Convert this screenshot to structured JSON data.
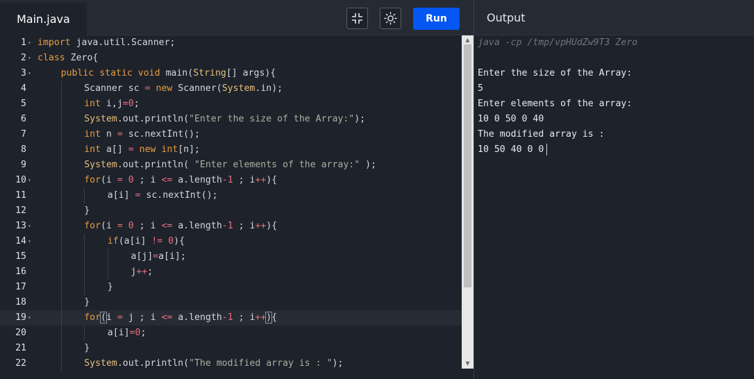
{
  "editor": {
    "tab_label": "Main.java",
    "run_label": "Run",
    "lines": [
      {
        "num": "1",
        "indent": 0,
        "fold": true
      },
      {
        "num": "2",
        "indent": 0,
        "fold": true
      },
      {
        "num": "3",
        "indent": 1,
        "fold": true
      },
      {
        "num": "4",
        "indent": 2
      },
      {
        "num": "5",
        "indent": 2
      },
      {
        "num": "6",
        "indent": 2
      },
      {
        "num": "7",
        "indent": 2
      },
      {
        "num": "8",
        "indent": 2
      },
      {
        "num": "9",
        "indent": 2
      },
      {
        "num": "10",
        "indent": 2,
        "fold": true
      },
      {
        "num": "11",
        "indent": 3
      },
      {
        "num": "12",
        "indent": 2
      },
      {
        "num": "13",
        "indent": 2,
        "fold": true
      },
      {
        "num": "14",
        "indent": 3,
        "fold": true
      },
      {
        "num": "15",
        "indent": 4
      },
      {
        "num": "16",
        "indent": 4
      },
      {
        "num": "17",
        "indent": 3
      },
      {
        "num": "18",
        "indent": 2
      },
      {
        "num": "19",
        "indent": 2,
        "fold": true,
        "active": true
      },
      {
        "num": "20",
        "indent": 3
      },
      {
        "num": "21",
        "indent": 2
      },
      {
        "num": "22",
        "indent": 2
      }
    ],
    "tokens": {
      "l1": [
        [
          "kw",
          "import"
        ],
        [
          "sy",
          " java.util.Scanner;"
        ]
      ],
      "l2": [
        [
          "kw",
          "class"
        ],
        [
          "sy",
          " Zero{"
        ]
      ],
      "l3": [
        [
          "kw",
          "public"
        ],
        [
          "sy",
          " "
        ],
        [
          "kw",
          "static"
        ],
        [
          "sy",
          " "
        ],
        [
          "kw",
          "void"
        ],
        [
          "sy",
          " main("
        ],
        [
          "ty",
          "String"
        ],
        [
          "sy",
          "[] args){"
        ]
      ],
      "l4": [
        [
          "sy",
          "Scanner sc "
        ],
        [
          "op",
          "="
        ],
        [
          "sy",
          " "
        ],
        [
          "kw",
          "new"
        ],
        [
          "sy",
          " Scanner("
        ],
        [
          "ty",
          "System"
        ],
        [
          "sy",
          ".in);"
        ]
      ],
      "l5": [
        [
          "kw",
          "int"
        ],
        [
          "sy",
          " i,j"
        ],
        [
          "op",
          "="
        ],
        [
          "nm",
          "0"
        ],
        [
          "sy",
          ";"
        ]
      ],
      "l6": [
        [
          "ty",
          "System"
        ],
        [
          "sy",
          ".out.println("
        ],
        [
          "st",
          "\"Enter the size of the Array:\""
        ],
        [
          "sy",
          ");"
        ]
      ],
      "l7": [
        [
          "kw",
          "int"
        ],
        [
          "sy",
          " n "
        ],
        [
          "op",
          "="
        ],
        [
          "sy",
          " sc.nextInt();"
        ]
      ],
      "l8": [
        [
          "kw",
          "int"
        ],
        [
          "sy",
          " a[] "
        ],
        [
          "op",
          "="
        ],
        [
          "sy",
          " "
        ],
        [
          "kw",
          "new"
        ],
        [
          "sy",
          " "
        ],
        [
          "kw",
          "int"
        ],
        [
          "sy",
          "[n];"
        ]
      ],
      "l9": [
        [
          "ty",
          "System"
        ],
        [
          "sy",
          ".out.println( "
        ],
        [
          "st",
          "\"Enter elements of the array:\""
        ],
        [
          "sy",
          " );"
        ]
      ],
      "l10": [
        [
          "kw",
          "for"
        ],
        [
          "sy",
          "(i "
        ],
        [
          "op",
          "="
        ],
        [
          "sy",
          " "
        ],
        [
          "nm",
          "0"
        ],
        [
          "sy",
          " ; i "
        ],
        [
          "op",
          "<="
        ],
        [
          "sy",
          " a.length"
        ],
        [
          "op",
          "-1"
        ],
        [
          "sy",
          " ; i"
        ],
        [
          "op",
          "++"
        ],
        [
          "sy",
          "){"
        ]
      ],
      "l11": [
        [
          "sy",
          "a[i] "
        ],
        [
          "op",
          "="
        ],
        [
          "sy",
          " sc.nextInt();"
        ]
      ],
      "l12": [
        [
          "sy",
          "}"
        ]
      ],
      "l13": [
        [
          "kw",
          "for"
        ],
        [
          "sy",
          "(i "
        ],
        [
          "op",
          "="
        ],
        [
          "sy",
          " "
        ],
        [
          "nm",
          "0"
        ],
        [
          "sy",
          " ; i "
        ],
        [
          "op",
          "<="
        ],
        [
          "sy",
          " a.length"
        ],
        [
          "op",
          "-1"
        ],
        [
          "sy",
          " ; i"
        ],
        [
          "op",
          "++"
        ],
        [
          "sy",
          "){"
        ]
      ],
      "l14": [
        [
          "kw",
          "if"
        ],
        [
          "sy",
          "(a[i] "
        ],
        [
          "op",
          "!="
        ],
        [
          "sy",
          " "
        ],
        [
          "nm",
          "0"
        ],
        [
          "sy",
          "){"
        ]
      ],
      "l15": [
        [
          "sy",
          "a[j]"
        ],
        [
          "op",
          "="
        ],
        [
          "sy",
          "a[i];"
        ]
      ],
      "l16": [
        [
          "sy",
          "j"
        ],
        [
          "op",
          "++"
        ],
        [
          "sy",
          ";"
        ]
      ],
      "l17": [
        [
          "sy",
          "}"
        ]
      ],
      "l18": [
        [
          "sy",
          "}"
        ]
      ],
      "l19": [
        [
          "kw",
          "for"
        ],
        [
          "box",
          "("
        ],
        [
          "sy",
          "i "
        ],
        [
          "op",
          "="
        ],
        [
          "sy",
          " j ; i "
        ],
        [
          "op",
          "<="
        ],
        [
          "sy",
          " a.length"
        ],
        [
          "op",
          "-1"
        ],
        [
          "sy",
          " ; i"
        ],
        [
          "op",
          "++"
        ],
        [
          "box",
          ")"
        ],
        [
          "sy",
          "{"
        ]
      ],
      "l20": [
        [
          "sy",
          "a[i]"
        ],
        [
          "op",
          "="
        ],
        [
          "nm",
          "0"
        ],
        [
          "sy",
          ";"
        ]
      ],
      "l21": [
        [
          "sy",
          "}"
        ]
      ],
      "l22": [
        [
          "ty",
          "System"
        ],
        [
          "sy",
          ".out.println("
        ],
        [
          "st",
          "\"The modified array is : \""
        ],
        [
          "sy",
          ");"
        ]
      ]
    }
  },
  "output": {
    "title": "Output",
    "command": "java -cp /tmp/vpHUdZw9T3 Zero",
    "lines": [
      "Enter the size of the Array:",
      "5",
      "Enter elements of the array:",
      "10 0 50 0 40",
      "The modified array is :",
      "10 50 40 0 0"
    ]
  },
  "icons": {
    "collapse": "collapse-icon",
    "theme": "sun-icon"
  },
  "colors": {
    "run_button": "#0556f3",
    "background": "#1d222b"
  }
}
